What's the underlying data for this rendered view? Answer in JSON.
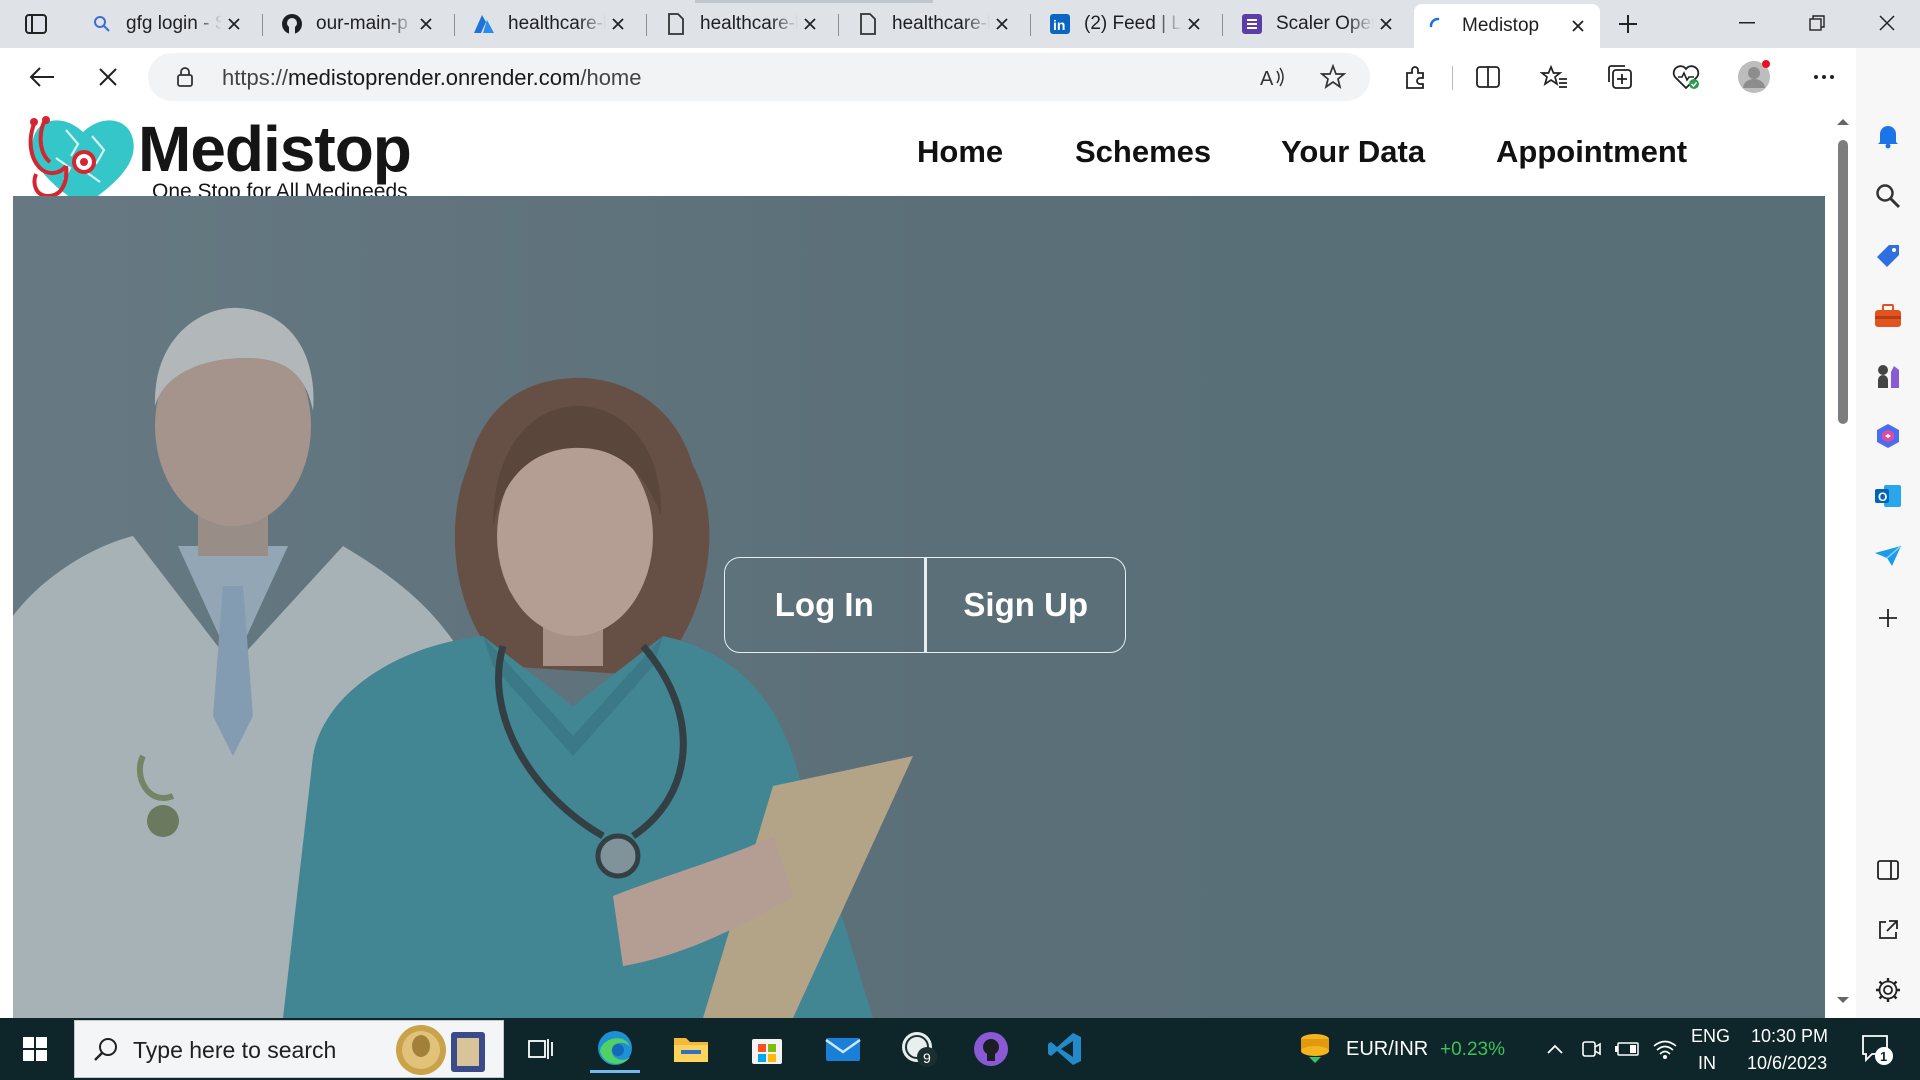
{
  "browser": {
    "tabs": [
      {
        "title": "gfg login - S",
        "icon": "search-icon"
      },
      {
        "title": "our-main-p",
        "icon": "github-icon"
      },
      {
        "title": "healthcare-l",
        "icon": "azure-icon"
      },
      {
        "title": "healthcare-l",
        "icon": "page-icon"
      },
      {
        "title": "healthcare-l",
        "icon": "page-icon"
      },
      {
        "title": "(2) Feed | Li",
        "icon": "linkedin-icon"
      },
      {
        "title": "Scaler Oper",
        "icon": "scaler-icon"
      },
      {
        "title": "Medistop",
        "icon": "loading-icon",
        "active": true
      }
    ],
    "url_prefix": "https://",
    "url_host": "medistoprender.onrender.com",
    "url_path": "/home"
  },
  "page": {
    "brand": "Medistop",
    "tagline": "One Stop for All Medineeds",
    "nav": [
      "Home",
      "Schemes",
      "Your Data",
      "Appointment"
    ],
    "auth": {
      "login": "Log In",
      "signup": "Sign Up"
    }
  },
  "taskbar": {
    "search_placeholder": "Type here to search",
    "currency_pair": "EUR/INR",
    "currency_change": "+0.23%",
    "lang_top": "ENG",
    "lang_bottom": "IN",
    "time": "10:30 PM",
    "date": "10/6/2023",
    "notification_count": "1",
    "app_badge": "9"
  },
  "colors": {
    "hero_overlay": "#5a6f78",
    "logo_teal": "#34c6c9",
    "stethoscope_red": "#d22630",
    "taskbar_bg": "#0e2629",
    "currency_up": "#3cc15b"
  }
}
